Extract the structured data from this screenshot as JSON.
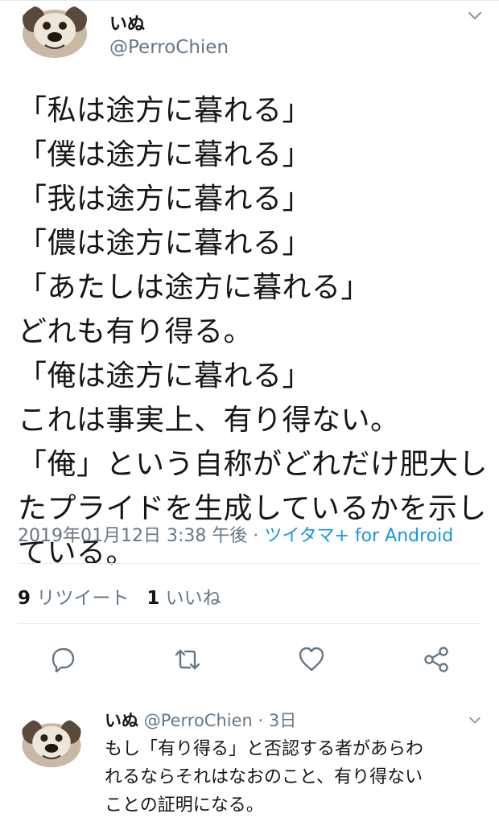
{
  "tweet": {
    "author_name": "いぬ",
    "author_handle": "@PerroChien",
    "text_lines": [
      "「私は途方に暮れる」",
      "「僕は途方に暮れる」",
      "「我は途方に暮れる」",
      "「儂は途方に暮れる」",
      "「あたしは途方に暮れる」",
      "どれも有り得る。",
      "「俺は途方に暮れる」",
      "これは事実上、有り得ない。",
      "「俺」という自称がどれだけ肥大し",
      "たプライドを生成しているかを示し",
      "ている。"
    ],
    "timestamp": "2019年01月12日 3:38 午後",
    "separator": " · ",
    "via": "ツイタマ+ for Android",
    "retweet_count": "9",
    "retweet_label": "リツイート",
    "like_count": "1",
    "like_label": "いいね"
  },
  "actions": {
    "reply_icon": "reply-icon",
    "retweet_icon": "retweet-icon",
    "like_icon": "heart-icon",
    "share_icon": "share-icon"
  },
  "reply": {
    "author_name": "いぬ",
    "author_handle": "@PerroChien",
    "separator": " · ",
    "age": "3日",
    "text_lines": [
      "もし「有り得る」と否認する者があらわ",
      "れるならそれはなおのこと、有り得ない",
      "ことの証明になる。"
    ]
  },
  "colors": {
    "text": "#14171a",
    "secondary": "#657786",
    "link": "#1b95e0",
    "divider": "#e1e8ed"
  }
}
